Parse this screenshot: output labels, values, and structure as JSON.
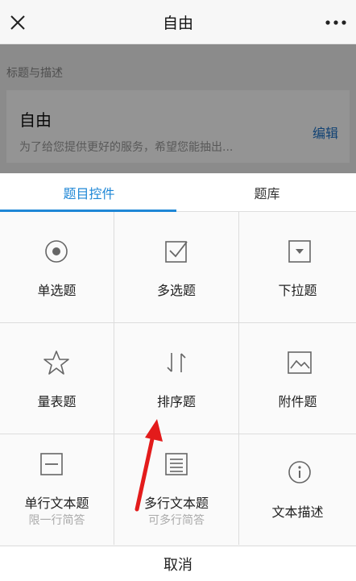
{
  "nav": {
    "title": "自由",
    "close_icon": "close-icon",
    "more_icon": "more-icon"
  },
  "background": {
    "section_title": "标题与描述",
    "card_title": "自由",
    "card_desc": "为了给您提供更好的服务，希望您能抽出...",
    "edit_label": "编辑"
  },
  "sheet": {
    "tabs": [
      {
        "label": "题目控件",
        "active": true
      },
      {
        "label": "题库",
        "active": false
      }
    ],
    "items": [
      {
        "label": "单选题",
        "icon": "radio-icon"
      },
      {
        "label": "多选题",
        "icon": "checkbox-icon"
      },
      {
        "label": "下拉题",
        "icon": "dropdown-icon"
      },
      {
        "label": "量表题",
        "icon": "star-icon"
      },
      {
        "label": "排序题",
        "icon": "sort-icon"
      },
      {
        "label": "附件题",
        "icon": "image-icon"
      },
      {
        "label": "单行文本题",
        "sub": "限一行简答",
        "icon": "single-line-icon"
      },
      {
        "label": "多行文本题",
        "sub": "可多行简答",
        "icon": "multi-line-icon"
      },
      {
        "label": "文本描述",
        "icon": "info-icon"
      }
    ],
    "cancel_label": "取消"
  },
  "colors": {
    "accent": "#1e87d6",
    "link": "#1e73c8",
    "annotation_arrow": "#e31b1b"
  }
}
